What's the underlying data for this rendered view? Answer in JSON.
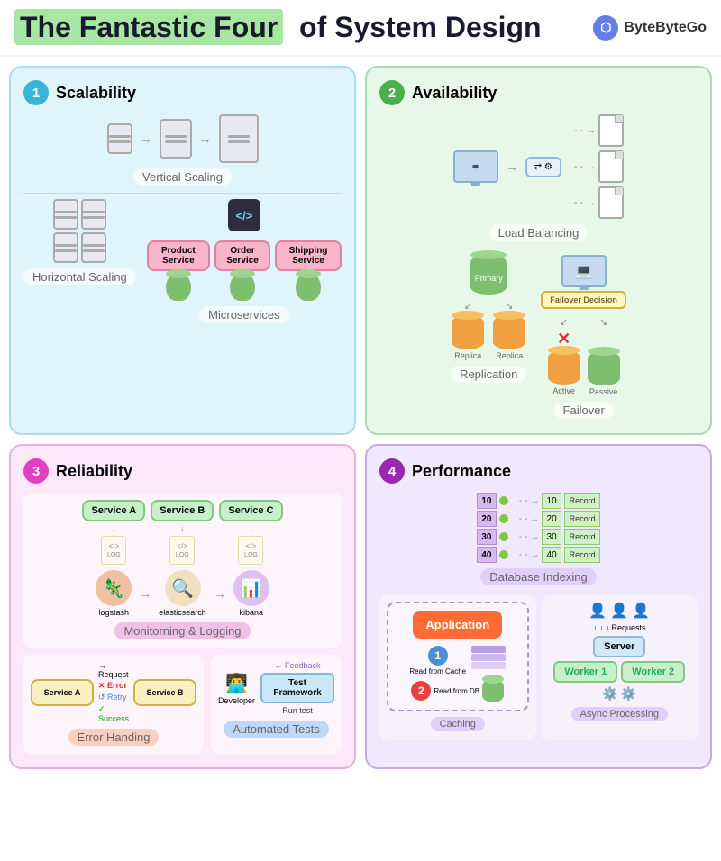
{
  "header": {
    "title_part1": "The Fantastic Four",
    "title_part2": "of System Design",
    "brand_name": "ByteByteGo",
    "brand_symbol": "⬡"
  },
  "q1": {
    "num": "1",
    "title": "Scalability",
    "vertical_label": "Vertical Scaling",
    "horizontal_label": "Horizontal Scaling",
    "microservices_label": "Microservices",
    "services": [
      "Product Service",
      "Order Service",
      "Shipping Service"
    ]
  },
  "q2": {
    "num": "2",
    "title": "Availability",
    "lb_label": "Load Balancing",
    "replication_label": "Replication",
    "failover_label": "Failover",
    "primary_label": "Primary",
    "replica_labels": [
      "Replica",
      "Replica"
    ],
    "failover_decision": "Failover Decision",
    "active_label": "Active",
    "passive_label": "Passive"
  },
  "q3": {
    "num": "3",
    "title": "Reliability",
    "services": [
      "Service A",
      "Service B",
      "Service C"
    ],
    "log_label": "LOG",
    "tools": [
      "logstash",
      "elasticsearch",
      "kibana"
    ],
    "monitoring_label": "Monitorning & Logging",
    "error_label": "Error Handing",
    "tests_label": "Automated Tests",
    "service_a": "Service A",
    "service_b": "Service B",
    "request_label": "Request",
    "error_label2": "Error",
    "retry_label": "Retry",
    "success_label": "Success",
    "feedback_label": "Feedback",
    "feedback_label2": "Feedback",
    "developer_label": "Developer",
    "run_test_label": "Run test",
    "test_fw_label": "Test Framework"
  },
  "q4": {
    "num": "4",
    "title": "Performance",
    "db_index_label": "Database Indexing",
    "caching_label": "Caching",
    "async_label": "Async Processing",
    "app_label": "Application",
    "read_cache_label": "Read from Cache",
    "read_db_label": "Read from DB",
    "server_label": "Server",
    "worker1_label": "Worker 1",
    "worker2_label": "Worker 2",
    "requests_label": "Requests",
    "index_nums": [
      "10",
      "20",
      "30",
      "40"
    ],
    "record_label": "Record"
  }
}
